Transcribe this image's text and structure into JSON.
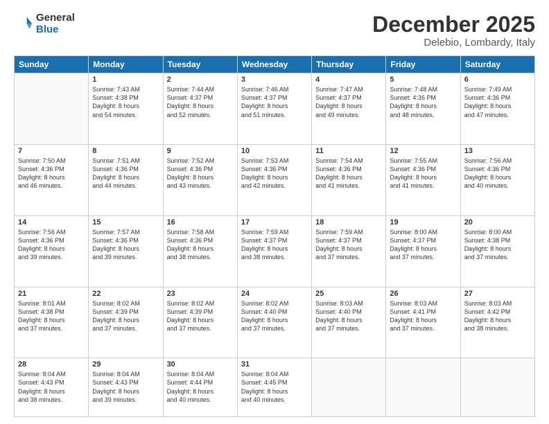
{
  "header": {
    "logo_general": "General",
    "logo_blue": "Blue",
    "month": "December 2025",
    "location": "Delebio, Lombardy, Italy"
  },
  "days_of_week": [
    "Sunday",
    "Monday",
    "Tuesday",
    "Wednesday",
    "Thursday",
    "Friday",
    "Saturday"
  ],
  "weeks": [
    [
      {
        "day": "",
        "info": ""
      },
      {
        "day": "1",
        "info": "Sunrise: 7:43 AM\nSunset: 4:38 PM\nDaylight: 8 hours\nand 54 minutes."
      },
      {
        "day": "2",
        "info": "Sunrise: 7:44 AM\nSunset: 4:37 PM\nDaylight: 8 hours\nand 52 minutes."
      },
      {
        "day": "3",
        "info": "Sunrise: 7:46 AM\nSunset: 4:37 PM\nDaylight: 8 hours\nand 51 minutes."
      },
      {
        "day": "4",
        "info": "Sunrise: 7:47 AM\nSunset: 4:37 PM\nDaylight: 8 hours\nand 49 minutes."
      },
      {
        "day": "5",
        "info": "Sunrise: 7:48 AM\nSunset: 4:36 PM\nDaylight: 8 hours\nand 48 minutes."
      },
      {
        "day": "6",
        "info": "Sunrise: 7:49 AM\nSunset: 4:36 PM\nDaylight: 8 hours\nand 47 minutes."
      }
    ],
    [
      {
        "day": "7",
        "info": "Sunrise: 7:50 AM\nSunset: 4:36 PM\nDaylight: 8 hours\nand 46 minutes."
      },
      {
        "day": "8",
        "info": "Sunrise: 7:51 AM\nSunset: 4:36 PM\nDaylight: 8 hours\nand 44 minutes."
      },
      {
        "day": "9",
        "info": "Sunrise: 7:52 AM\nSunset: 4:36 PM\nDaylight: 8 hours\nand 43 minutes."
      },
      {
        "day": "10",
        "info": "Sunrise: 7:53 AM\nSunset: 4:36 PM\nDaylight: 8 hours\nand 42 minutes."
      },
      {
        "day": "11",
        "info": "Sunrise: 7:54 AM\nSunset: 4:36 PM\nDaylight: 8 hours\nand 41 minutes."
      },
      {
        "day": "12",
        "info": "Sunrise: 7:55 AM\nSunset: 4:36 PM\nDaylight: 8 hours\nand 41 minutes."
      },
      {
        "day": "13",
        "info": "Sunrise: 7:56 AM\nSunset: 4:36 PM\nDaylight: 8 hours\nand 40 minutes."
      }
    ],
    [
      {
        "day": "14",
        "info": "Sunrise: 7:56 AM\nSunset: 4:36 PM\nDaylight: 8 hours\nand 39 minutes."
      },
      {
        "day": "15",
        "info": "Sunrise: 7:57 AM\nSunset: 4:36 PM\nDaylight: 8 hours\nand 39 minutes."
      },
      {
        "day": "16",
        "info": "Sunrise: 7:58 AM\nSunset: 4:36 PM\nDaylight: 8 hours\nand 38 minutes."
      },
      {
        "day": "17",
        "info": "Sunrise: 7:59 AM\nSunset: 4:37 PM\nDaylight: 8 hours\nand 38 minutes."
      },
      {
        "day": "18",
        "info": "Sunrise: 7:59 AM\nSunset: 4:37 PM\nDaylight: 8 hours\nand 37 minutes."
      },
      {
        "day": "19",
        "info": "Sunrise: 8:00 AM\nSunset: 4:37 PM\nDaylight: 8 hours\nand 37 minutes."
      },
      {
        "day": "20",
        "info": "Sunrise: 8:00 AM\nSunset: 4:38 PM\nDaylight: 8 hours\nand 37 minutes."
      }
    ],
    [
      {
        "day": "21",
        "info": "Sunrise: 8:01 AM\nSunset: 4:38 PM\nDaylight: 8 hours\nand 37 minutes."
      },
      {
        "day": "22",
        "info": "Sunrise: 8:02 AM\nSunset: 4:39 PM\nDaylight: 8 hours\nand 37 minutes."
      },
      {
        "day": "23",
        "info": "Sunrise: 8:02 AM\nSunset: 4:39 PM\nDaylight: 8 hours\nand 37 minutes."
      },
      {
        "day": "24",
        "info": "Sunrise: 8:02 AM\nSunset: 4:40 PM\nDaylight: 8 hours\nand 37 minutes."
      },
      {
        "day": "25",
        "info": "Sunrise: 8:03 AM\nSunset: 4:40 PM\nDaylight: 8 hours\nand 37 minutes."
      },
      {
        "day": "26",
        "info": "Sunrise: 8:03 AM\nSunset: 4:41 PM\nDaylight: 8 hours\nand 37 minutes."
      },
      {
        "day": "27",
        "info": "Sunrise: 8:03 AM\nSunset: 4:42 PM\nDaylight: 8 hours\nand 38 minutes."
      }
    ],
    [
      {
        "day": "28",
        "info": "Sunrise: 8:04 AM\nSunset: 4:43 PM\nDaylight: 8 hours\nand 38 minutes."
      },
      {
        "day": "29",
        "info": "Sunrise: 8:04 AM\nSunset: 4:43 PM\nDaylight: 8 hours\nand 39 minutes."
      },
      {
        "day": "30",
        "info": "Sunrise: 8:04 AM\nSunset: 4:44 PM\nDaylight: 8 hours\nand 40 minutes."
      },
      {
        "day": "31",
        "info": "Sunrise: 8:04 AM\nSunset: 4:45 PM\nDaylight: 8 hours\nand 40 minutes."
      },
      {
        "day": "",
        "info": ""
      },
      {
        "day": "",
        "info": ""
      },
      {
        "day": "",
        "info": ""
      }
    ]
  ]
}
